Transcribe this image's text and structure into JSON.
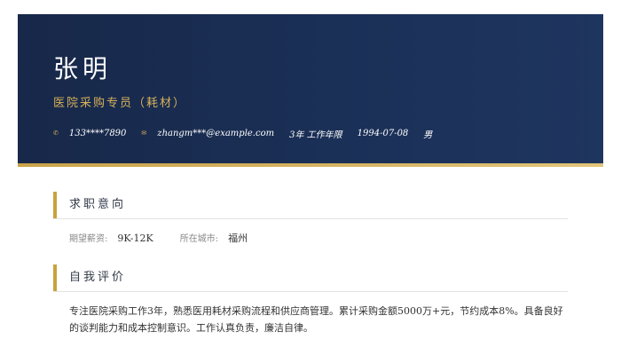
{
  "header": {
    "name": "张明",
    "job_title": "医院采购专员（耗材）",
    "contacts": {
      "phone_icon": "✆",
      "phone": "133****7890",
      "email_icon": "✉",
      "email": "zhangm***@example.com",
      "experience": "3年 工作年限",
      "birthdate": "1994-07-08",
      "gender": "男"
    }
  },
  "sections": {
    "intention": {
      "title": "求职意向",
      "salary_label": "期望薪资:",
      "salary_value": "9K-12K",
      "city_label": "所在城市:",
      "city_value": "福州"
    },
    "self_evaluation": {
      "title": "自我评价",
      "text": "专注医院采购工作3年，熟悉医用耗材采购流程和供应商管理。累计采购金额5000万+元，节约成本8%。具备良好的谈判能力和成本控制意识。工作认真负责，廉洁自律。"
    }
  },
  "colors": {
    "header_bg": "#1b3057",
    "accent_gold": "#c9a23f",
    "text": "#333333"
  }
}
